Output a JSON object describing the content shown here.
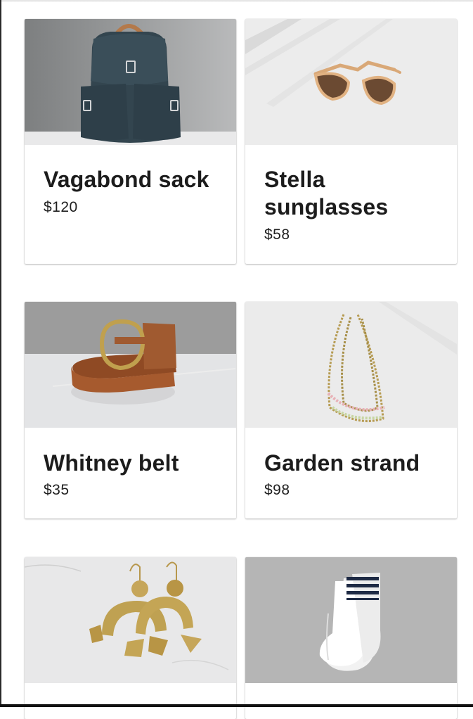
{
  "products": [
    {
      "name": "Vagabond sack",
      "price": "$120",
      "image": "backpack"
    },
    {
      "name": "Stella sunglasses",
      "price": "$58",
      "image": "sunglasses"
    },
    {
      "name": "Whitney belt",
      "price": "$35",
      "image": "belt"
    },
    {
      "name": "Garden strand",
      "price": "$98",
      "image": "necklace"
    },
    {
      "name": "",
      "price": "",
      "image": "earrings"
    },
    {
      "name": "",
      "price": "",
      "image": "socks"
    }
  ]
}
